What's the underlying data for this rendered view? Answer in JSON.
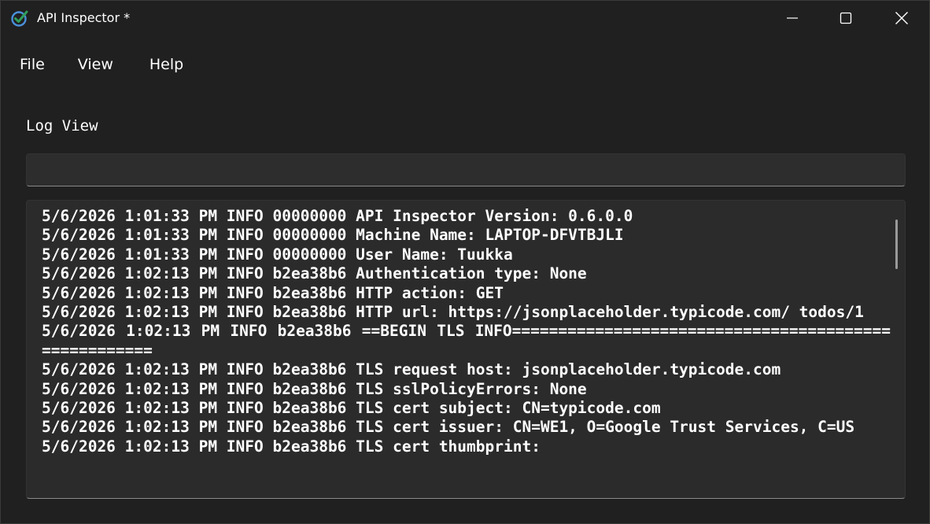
{
  "window": {
    "title": "API Inspector *",
    "accent_color": "#2f9e5a",
    "icons": {
      "app": "check-circle-icon",
      "minimize": "minimize-icon",
      "maximize": "maximize-icon",
      "close": "close-icon"
    }
  },
  "menubar": {
    "items": [
      {
        "label": "File"
      },
      {
        "label": "View"
      },
      {
        "label": "Help"
      }
    ]
  },
  "log_view": {
    "heading": "Log View",
    "filter": {
      "value": "",
      "placeholder": ""
    },
    "lines": [
      "5/6/2026 1:01:33 PM INFO 00000000 API Inspector Version: 0.6.0.0",
      "5/6/2026 1:01:33 PM INFO 00000000 Machine Name: LAPTOP-DFVTBJLI",
      "5/6/2026 1:01:33 PM INFO 00000000 User Name: Tuukka",
      "5/6/2026 1:02:13 PM INFO b2ea38b6 Authentication type: None",
      "5/6/2026 1:02:13 PM INFO b2ea38b6 HTTP action: GET",
      "5/6/2026 1:02:13 PM INFO b2ea38b6 HTTP url: https://jsonplaceholder.typicode.com/ todos/1",
      "5/6/2026 1:02:13 PM INFO b2ea38b6 ==BEGIN TLS INFO=====================================================",
      "5/6/2026 1:02:13 PM INFO b2ea38b6 TLS request host: jsonplaceholder.typicode.com",
      "5/6/2026 1:02:13 PM INFO b2ea38b6 TLS sslPolicyErrors: None",
      "5/6/2026 1:02:13 PM INFO b2ea38b6 TLS cert subject: CN=typicode.com",
      "5/6/2026 1:02:13 PM INFO b2ea38b6 TLS cert issuer: CN=WE1, O=Google Trust Services, C=US",
      "5/6/2026 1:02:13 PM INFO b2ea38b6 TLS cert thumbprint:"
    ]
  }
}
